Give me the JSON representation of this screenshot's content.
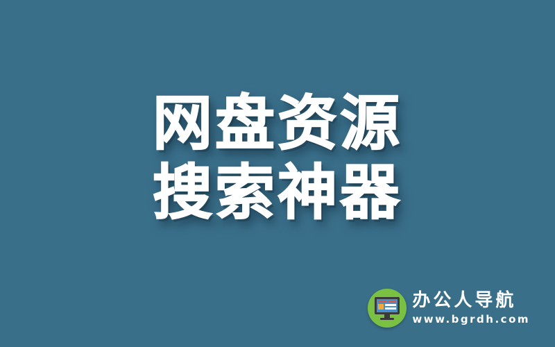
{
  "colors": {
    "background": "#3a6f8a",
    "title_text": "#ffffff",
    "logo_circle": "#7ac143",
    "monitor_frame": "#3a3a3a",
    "monitor_screen": "#4a90c8",
    "screen_accent_red": "#e8533a",
    "screen_accent_orange": "#f2a93b"
  },
  "title": {
    "line1": "网盘资源",
    "line2": "搜索神器"
  },
  "brand": {
    "logo_icon": "monitor-icon",
    "name": "办公人导航",
    "url": "www.bgrdh.com"
  }
}
